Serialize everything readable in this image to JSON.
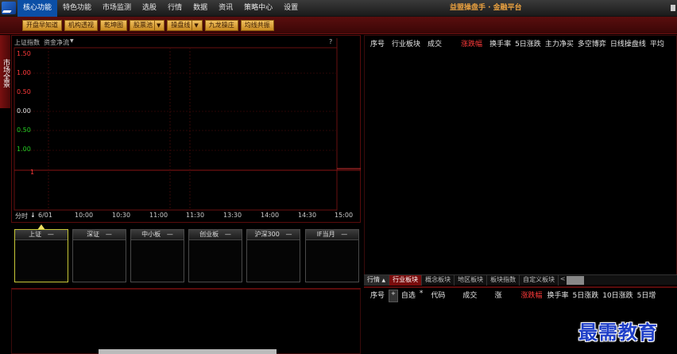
{
  "menu": {
    "items": [
      "核心功能",
      "特色功能",
      "市场监测",
      "选股",
      "行情",
      "数据",
      "资讯",
      "策略中心",
      "设置"
    ],
    "active_index": 0
  },
  "app_title": "益盟操盘手 · 金融平台",
  "toolbar": {
    "buttons": [
      {
        "label": "开盘早知道",
        "dropdown": false
      },
      {
        "label": "机构透视",
        "dropdown": false
      },
      {
        "label": "乾坤图",
        "dropdown": false
      },
      {
        "label": "股票池",
        "dropdown": true
      },
      {
        "label": "操盘线",
        "dropdown": true
      },
      {
        "label": "九龙操庄",
        "dropdown": false
      },
      {
        "label": "均线共振",
        "dropdown": false
      }
    ]
  },
  "side_tab": {
    "label": "市场全景"
  },
  "chart": {
    "header_index": "上证指数",
    "header_indicator": "资金净流",
    "header_help": "?",
    "y_labels": [
      "1.50",
      "1.00",
      "0.50",
      "0.00",
      "0.50",
      "1.00",
      "1"
    ],
    "time_period_label": "分时",
    "time_arrow": "↓",
    "x_labels": [
      "6/01",
      "10:00",
      "10:30",
      "11:00",
      "11:30",
      "13:30",
      "14:00",
      "14:30",
      "15:00"
    ]
  },
  "index_boxes": [
    {
      "label": "上证",
      "value": "—"
    },
    {
      "label": "深证",
      "value": "—"
    },
    {
      "label": "中小板",
      "value": "—"
    },
    {
      "label": "创业板",
      "value": "—"
    },
    {
      "label": "沪深300",
      "value": "—"
    },
    {
      "label": "IF当月",
      "value": "—"
    }
  ],
  "sector_table": {
    "columns": [
      "序号",
      "行业板块",
      "成交",
      "涨跌幅",
      "换手率",
      "5日涨跌",
      "主力净买",
      "多空博弈",
      "日线操盘线",
      "平均"
    ],
    "sort_column_index": 3
  },
  "tabs": {
    "items": [
      "行情",
      "行业板块",
      "概念板块",
      "地区板块",
      "板块指数",
      "自定义板块"
    ],
    "first_dropdown": "▲",
    "active_index": 1,
    "scroll_left": "<"
  },
  "stock_table": {
    "columns": [
      "序号",
      "+",
      "自选",
      "*",
      "代码",
      "成交",
      "涨",
      "涨跌幅",
      "换手率",
      "5日涨跌",
      "10日涨跌",
      "5日增"
    ],
    "sort_column_index": 7
  },
  "watermark": "最需教育",
  "colors": {
    "accent_red": "#ff3a3a",
    "grid_red": "#6a0f0f",
    "menu_active": "#0b4fa6",
    "button_orange": "#e0a040",
    "positive_green": "#22cc22"
  }
}
